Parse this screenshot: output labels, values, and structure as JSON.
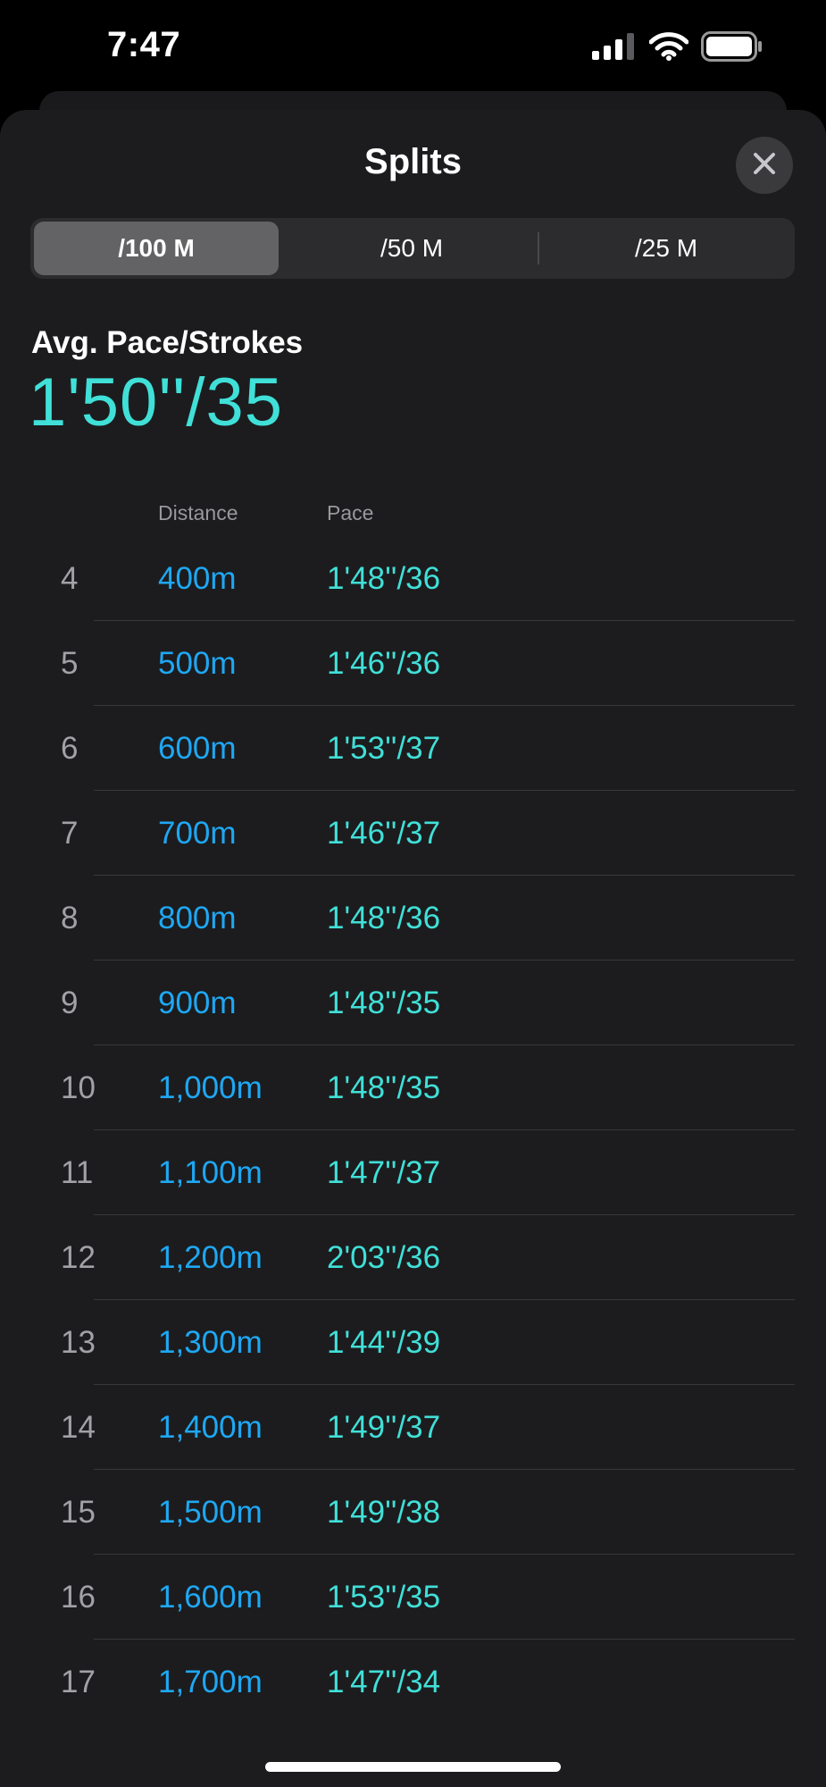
{
  "status_bar": {
    "time": "7:47"
  },
  "sheet": {
    "title": "Splits"
  },
  "segments": [
    {
      "label": "/100 M",
      "selected": true
    },
    {
      "label": "/50 M",
      "selected": false
    },
    {
      "label": "/25 M",
      "selected": false
    }
  ],
  "summary": {
    "label": "Avg. Pace/Strokes",
    "value": "1'50''/35"
  },
  "table": {
    "headers": {
      "distance": "Distance",
      "pace": "Pace"
    },
    "rows": [
      {
        "index": "4",
        "distance": "400m",
        "pace": "1'48''/36"
      },
      {
        "index": "5",
        "distance": "500m",
        "pace": "1'46''/36"
      },
      {
        "index": "6",
        "distance": "600m",
        "pace": "1'53''/37"
      },
      {
        "index": "7",
        "distance": "700m",
        "pace": "1'46''/37"
      },
      {
        "index": "8",
        "distance": "800m",
        "pace": "1'48''/36"
      },
      {
        "index": "9",
        "distance": "900m",
        "pace": "1'48''/35"
      },
      {
        "index": "10",
        "distance": "1,000m",
        "pace": "1'48''/35"
      },
      {
        "index": "11",
        "distance": "1,100m",
        "pace": "1'47''/37"
      },
      {
        "index": "12",
        "distance": "1,200m",
        "pace": "2'03''/36"
      },
      {
        "index": "13",
        "distance": "1,300m",
        "pace": "1'44''/39"
      },
      {
        "index": "14",
        "distance": "1,400m",
        "pace": "1'49''/37"
      },
      {
        "index": "15",
        "distance": "1,500m",
        "pace": "1'49''/38"
      },
      {
        "index": "16",
        "distance": "1,600m",
        "pace": "1'53''/35"
      },
      {
        "index": "17",
        "distance": "1,700m",
        "pace": "1'47''/34"
      }
    ]
  },
  "icons": {
    "signal": "cellular-signal-icon",
    "wifi": "wifi-icon",
    "battery": "battery-icon",
    "close": "close-icon"
  },
  "colors": {
    "pace_accent": "#40e0d8",
    "distance_accent": "#1ea8f4",
    "sheet_background": "#1c1c1e"
  }
}
